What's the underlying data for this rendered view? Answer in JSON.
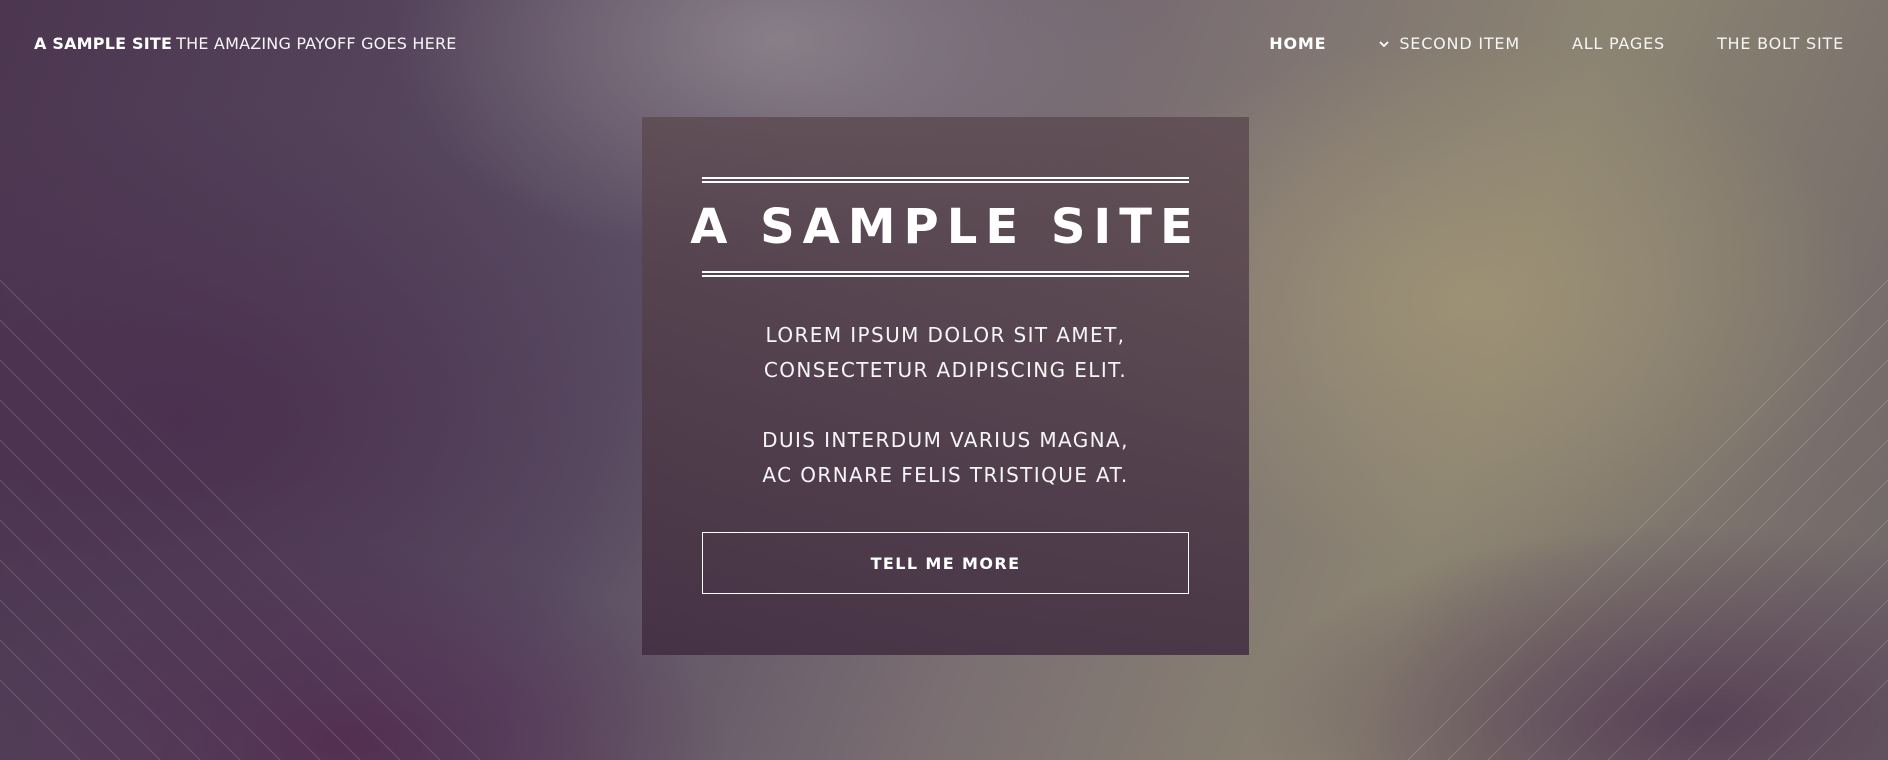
{
  "header": {
    "brand_name": "A SAMPLE SITE",
    "brand_tagline": "THE AMAZING PAYOFF GOES HERE"
  },
  "nav": {
    "items": [
      {
        "label": "HOME",
        "active": true
      },
      {
        "label": "SECOND ITEM",
        "has_dropdown": true,
        "icon": "chevron-down-icon"
      },
      {
        "label": "ALL PAGES"
      },
      {
        "label": "THE BOLT SITE"
      }
    ]
  },
  "hero": {
    "title": "A SAMPLE SITE",
    "paragraph1": [
      "LOREM IPSUM DOLOR SIT AMET,",
      "CONSECTETUR ADIPISCING ELIT."
    ],
    "paragraph2": [
      "DUIS INTERDUM VARIUS MAGNA,",
      "AC ORNARE FELIS TRISTIQUE AT."
    ],
    "button_label": "TELL ME MORE"
  },
  "colors": {
    "text": "#ffffff",
    "card_background": "#4e3a4e",
    "background_dark": "#4c3650",
    "background_light": "#a0947a"
  }
}
